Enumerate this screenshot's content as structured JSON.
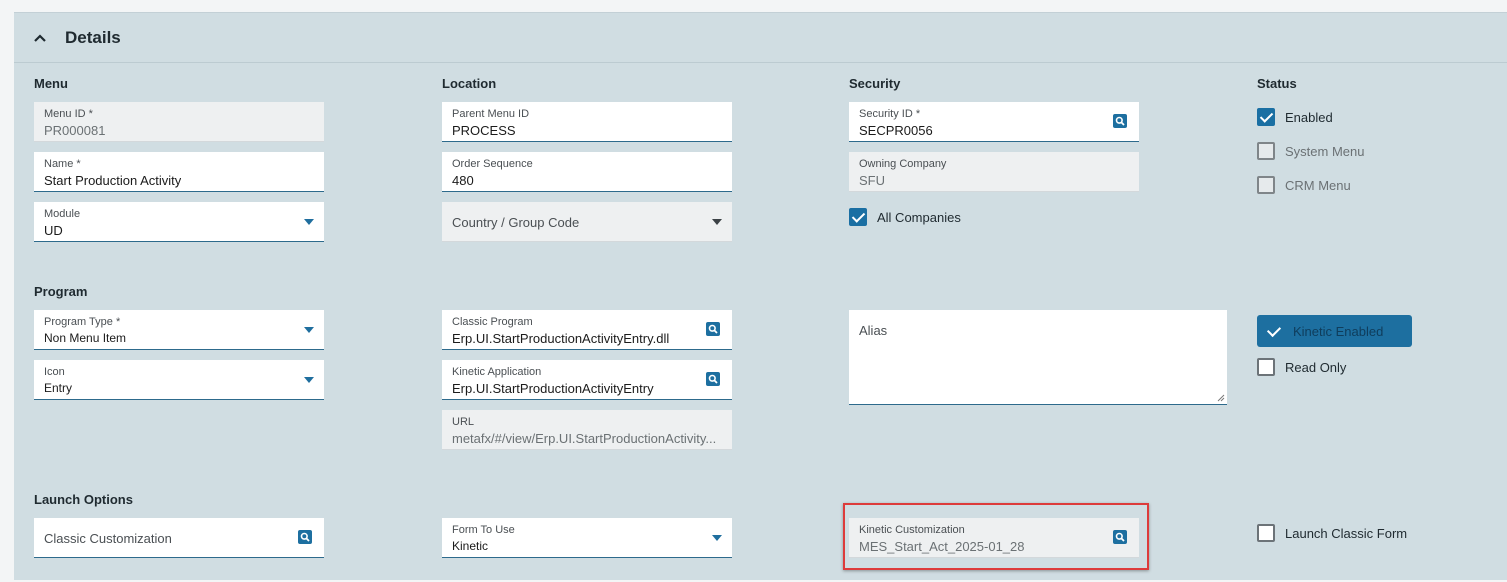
{
  "header": {
    "title": "Details",
    "collapse_icon": "chevron-up-icon"
  },
  "sections": {
    "menu": "Menu",
    "location": "Location",
    "security": "Security",
    "status": "Status",
    "program": "Program",
    "launch_options": "Launch Options"
  },
  "menu": {
    "menu_id": {
      "label": "Menu ID *",
      "value": "PR000081"
    },
    "name": {
      "label": "Name *",
      "value": "Start Production Activity"
    },
    "module": {
      "label": "Module",
      "value": "UD"
    }
  },
  "location": {
    "parent_menu_id": {
      "label": "Parent Menu ID",
      "value": "PROCESS"
    },
    "order_sequence": {
      "label": "Order Sequence",
      "value": "480"
    },
    "country_group_code": {
      "placeholder": "Country / Group Code"
    }
  },
  "security": {
    "security_id": {
      "label": "Security ID *",
      "value": "SECPR0056"
    },
    "owning_company": {
      "label": "Owning Company",
      "value": "SFU"
    },
    "all_companies": {
      "label": "All Companies",
      "checked": true
    }
  },
  "status": {
    "enabled": {
      "label": "Enabled",
      "checked": true
    },
    "system_menu": {
      "label": "System Menu",
      "checked": false
    },
    "crm_menu": {
      "label": "CRM Menu",
      "checked": false
    }
  },
  "program": {
    "program_type": {
      "label": "Program Type *",
      "value": "Non Menu Item"
    },
    "icon": {
      "label": "Icon",
      "value": "Entry"
    },
    "classic_program": {
      "label": "Classic Program",
      "value": "Erp.UI.StartProductionActivityEntry.dll"
    },
    "kinetic_application": {
      "label": "Kinetic Application",
      "value": "Erp.UI.StartProductionActivityEntry"
    },
    "url": {
      "label": "URL",
      "value": "metafx/#/view/Erp.UI.StartProductionActivity..."
    },
    "alias": {
      "placeholder": "Alias"
    },
    "kinetic_enabled": {
      "label": "Kinetic Enabled",
      "active": true
    },
    "read_only": {
      "label": "Read Only",
      "checked": false
    }
  },
  "launch": {
    "classic_customization": {
      "placeholder": "Classic Customization"
    },
    "form_to_use": {
      "label": "Form To Use",
      "value": "Kinetic"
    },
    "kinetic_customization": {
      "label": "Kinetic Customization",
      "value": "MES_Start_Act_2025-01_28"
    },
    "launch_classic_form": {
      "label": "Launch Classic Form",
      "checked": false
    }
  },
  "colors": {
    "accent": "#1d6fa0",
    "panel": "#d0dde2",
    "highlight": "#dd3b3b"
  }
}
